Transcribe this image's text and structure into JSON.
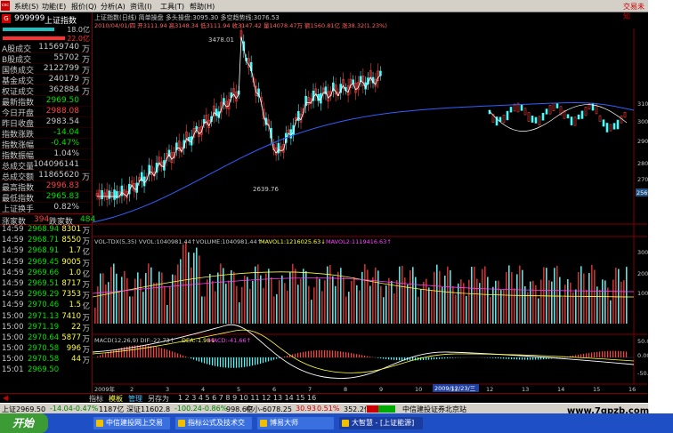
{
  "menu": {
    "items": [
      "系统(S)",
      "功能(E)",
      "报价(Q)",
      "分析(A)",
      "资讯(I)",
      "工具(T)",
      "帮助(H)"
    ],
    "brand": "交易未知"
  },
  "quote": {
    "code": "999999",
    "name": "上证指数",
    "bar_top_pct": "18.0亿",
    "bar_bottom_pct": "22.0亿",
    "rows": [
      {
        "label": "A股成交",
        "value": "11569740",
        "unit": "万",
        "color": "#c8c8c8"
      },
      {
        "label": "B股成交",
        "value": "55702",
        "unit": "万",
        "color": "#c8c8c8"
      },
      {
        "label": "国债成交",
        "value": "2122799",
        "unit": "万",
        "color": "#c8c8c8"
      },
      {
        "label": "基金成交",
        "value": "240179",
        "unit": "万",
        "color": "#c8c8c8"
      },
      {
        "label": "权证成交",
        "value": "362884",
        "unit": "万",
        "color": "#c8c8c8"
      },
      {
        "label": "最新指数",
        "value": "2969.50",
        "unit": "",
        "color": "#00e000"
      },
      {
        "label": "今日开盘",
        "value": "2988.08",
        "unit": "",
        "color": "#ff4040"
      },
      {
        "label": "昨日收盘",
        "value": "2983.54",
        "unit": "",
        "color": "#c8c8c8"
      },
      {
        "label": "指数涨跌",
        "value": "-14.04",
        "unit": "",
        "color": "#00e000"
      },
      {
        "label": "指数涨幅",
        "value": "-0.47%",
        "unit": "",
        "color": "#00e000"
      },
      {
        "label": "指数振幅",
        "value": "1.04%",
        "unit": "",
        "color": "#c8c8c8"
      },
      {
        "label": "总成交量",
        "value": "104096141",
        "unit": "",
        "color": "#c8c8c8"
      },
      {
        "label": "总成交额",
        "value": "11865620",
        "unit": "万",
        "color": "#c8c8c8"
      },
      {
        "label": "最高指数",
        "value": "2996.83",
        "unit": "",
        "color": "#ff4040"
      },
      {
        "label": "最低指数",
        "value": "2965.83",
        "unit": "",
        "color": "#00e000"
      },
      {
        "label": "上证换手",
        "value": "0.82%",
        "unit": "",
        "color": "#c8c8c8"
      }
    ],
    "up_label": "涨家数",
    "up_value": "394",
    "down_label": "跌家数",
    "down_value": "484",
    "ticks": [
      {
        "time": "14:59",
        "price": "2968.94",
        "vol": "8301",
        "unit": "万"
      },
      {
        "time": "14:59",
        "price": "2968.71",
        "vol": "8550",
        "unit": "万"
      },
      {
        "time": "14:59",
        "price": "2968.91",
        "vol": "1.7",
        "unit": "亿"
      },
      {
        "time": "14:59",
        "price": "2969.45",
        "vol": "9005",
        "unit": "万"
      },
      {
        "time": "14:59",
        "price": "2969.66",
        "vol": "1.0",
        "unit": "亿"
      },
      {
        "time": "14:59",
        "price": "2969.51",
        "vol": "8717",
        "unit": "万"
      },
      {
        "time": "14:59",
        "price": "2969.29",
        "vol": "7353",
        "unit": "万"
      },
      {
        "time": "14:59",
        "price": "2970.46",
        "vol": "1.5",
        "unit": "亿"
      },
      {
        "time": "15:00",
        "price": "2971.13",
        "vol": "7410",
        "unit": "万"
      },
      {
        "time": "15:00",
        "price": "2971.19",
        "vol": "22",
        "unit": "万"
      },
      {
        "time": "15:00",
        "price": "2970.64",
        "vol": "5877",
        "unit": "万"
      },
      {
        "time": "15:00",
        "price": "2970.58",
        "vol": "996",
        "unit": "万"
      },
      {
        "time": "15:00",
        "price": "2970.58",
        "vol": "44",
        "unit": "万"
      },
      {
        "time": "15:01",
        "price": "2969.50",
        "vol": "",
        "unit": ""
      }
    ]
  },
  "chart": {
    "header1": "上证指数(日线)  简单操盘  多头操盘:3095.30  多空趋势线:3076.53",
    "header2": "2010/04/01/四 开3111.94 高3148.34 低3111.94 收3147.42 量14078.47万 额1560.81亿 涨38.32(1.23%)",
    "price_axis": [
      "3100",
      "3000",
      "2900",
      "2800",
      "2700"
    ],
    "high_label": "3478.01",
    "low_label": "2639.76",
    "current_tag": "2569.1",
    "vol_header_a": "VOL-TDX(5,35) VVOL:1040981.44↑",
    "vol_header_b": "VOLUME:1040981.44↑",
    "vol_header_c": "MAVOL1:1216025.63↓",
    "vol_header_d": "MAVOL2:1119416.63↑",
    "vol_axis": [
      "3000",
      "2000",
      "1000"
    ],
    "macd_header_a": "MACD(12,26,9) DIF:-22.73↑",
    "macd_header_b": "DEA:-1.98↓",
    "macd_header_c": "MACD:-41.66↑",
    "macd_axis": [
      "50.00",
      "0.00",
      "-50.00"
    ],
    "date_tag": "2009/12/23/三",
    "x_labels": [
      "2009年",
      "2",
      "3",
      "4",
      "5",
      "6",
      "7",
      "8",
      "9",
      "10",
      "11",
      "12",
      "13",
      "14",
      "15",
      "16"
    ],
    "x_left_tag": "2009年"
  },
  "tabs": [
    "指标",
    "模板",
    "管理",
    "另存为"
  ],
  "status": {
    "sh": "上证2969.50",
    "sh_chg": "-14.04",
    "sh_pct": "-0.47%",
    "sh_vol": "1187亿",
    "sz": "深证11602.8",
    "sz_chg": "-100.24",
    "sz_pct": "-0.86%",
    "sz_vol": "998.6亿",
    "zx": "中小-6078.25",
    "zx_chg": "30.93",
    "zx_pct": "0.51%",
    "zx_vol": "352.2亿",
    "broker": "中信建投证券北京站"
  },
  "taskbar": {
    "start": "开始",
    "tasks": [
      "中信建投网上交易",
      "指标公式及技术交",
      "博易大师",
      "大智慧 - [上证能源]"
    ]
  },
  "watermark": "www.7gpzb.com"
}
